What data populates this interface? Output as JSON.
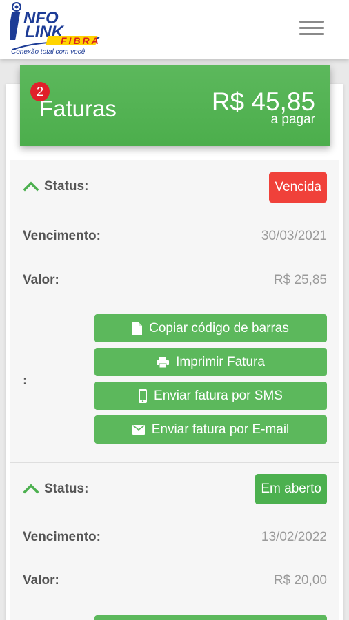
{
  "header": {
    "logo": {
      "line1": "NFO",
      "line2": "LINK",
      "brand": "FIBRA",
      "tagline": "Conexão total com você"
    },
    "menu_icon": "menu-icon"
  },
  "banner": {
    "badge_count": "2",
    "title": "Faturas",
    "amount": "R$ 45,85",
    "subtitle": "a pagar"
  },
  "invoices": [
    {
      "status_label": "Status:",
      "status": "Vencida",
      "status_color": "#f0413a",
      "due_label": "Vencimento:",
      "due": "30/03/2021",
      "value_label": "Valor:",
      "value": "R$ 25,85",
      "actions_label": ":",
      "actions": [
        {
          "label": "Copiar código de barras",
          "icon": "file-icon"
        },
        {
          "label": "Imprimir Fatura",
          "icon": "printer-icon"
        },
        {
          "label": "Enviar fatura por SMS",
          "icon": "phone-icon"
        },
        {
          "label": "Enviar fatura por E-mail",
          "icon": "mail-icon"
        }
      ]
    },
    {
      "status_label": "Status:",
      "status": "Em aberto",
      "status_color": "#4cb04f",
      "due_label": "Vencimento:",
      "due": "13/02/2022",
      "value_label": "Valor:",
      "value": "R$ 20,00"
    }
  ],
  "colors": {
    "accent_green": "#5cb85c",
    "alert_red": "#f0413a",
    "badge_red": "#e0202a",
    "brand_blue": "#1d3c96",
    "brand_red": "#d62020"
  }
}
